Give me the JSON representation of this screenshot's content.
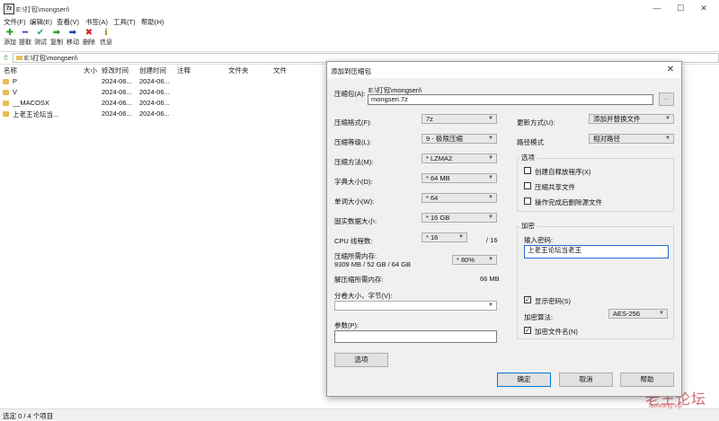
{
  "window": {
    "title": "E:\\打包\\mongseri\\",
    "minimize": "—",
    "maximize": "☐",
    "close": "✕"
  },
  "menu": [
    "文件(F)",
    "编辑(E)",
    "查看(V)",
    "书签(A)",
    "工具(T)",
    "帮助(H)"
  ],
  "toolbar": [
    {
      "label": "添加",
      "icon": "add-icon",
      "glyph": "✚",
      "color": "#2aa02a"
    },
    {
      "label": "提取",
      "icon": "extract-icon",
      "glyph": "━",
      "color": "#1f3fb0"
    },
    {
      "label": "测试",
      "icon": "test-icon",
      "glyph": "✔",
      "color": "#1f9b9b"
    },
    {
      "label": "复制",
      "icon": "copy-icon",
      "glyph": "➡",
      "color": "#2aa02a"
    },
    {
      "label": "移动",
      "icon": "move-icon",
      "glyph": "➡",
      "color": "#1f3fb0"
    },
    {
      "label": "删除",
      "icon": "delete-icon",
      "glyph": "✖",
      "color": "#cc2222"
    },
    {
      "label": "信息",
      "icon": "info-icon",
      "glyph": "ℹ",
      "color": "#b08a20"
    }
  ],
  "address": {
    "path": "E:\\打包\\mongseri\\",
    "up_glyph": "⇧"
  },
  "columns": [
    "名称",
    "大小",
    "修改时间",
    "创建时间",
    "注释",
    "文件夹",
    "文件"
  ],
  "files": [
    {
      "name": "P",
      "modified": "2024-06...",
      "created": "2024-06..."
    },
    {
      "name": "V",
      "modified": "2024-06...",
      "created": "2024-06..."
    },
    {
      "name": "__MACOSX",
      "modified": "2024-06...",
      "created": "2024-06..."
    },
    {
      "name": "上老王论坛当...",
      "modified": "2024-06...",
      "created": "2024-06..."
    }
  ],
  "status": {
    "text": "选定 0 / 4 个项目"
  },
  "watermark": {
    "main": "老王论坛",
    "sub": "laowang.vip"
  },
  "dialog": {
    "title": "添加到压缩包",
    "close": "✕",
    "archive_label": "压缩包(A):",
    "archive_dir": "E:\\打包\\mongseri\\",
    "archive_name": "mongseri.7z",
    "browse": "...",
    "format_label": "压缩格式(F):",
    "format_value": "7z",
    "level_label": "压缩等级(L):",
    "level_value": "9 - 极限压缩",
    "method_label": "压缩方法(M):",
    "method_value": "* LZMA2",
    "dict_label": "字典大小(D):",
    "dict_value": "* 64 MB",
    "word_label": "单词大小(W):",
    "word_value": "* 64",
    "solid_label": "固实数据大小:",
    "solid_value": "* 16 GB",
    "threads_label": "CPU 线程数:",
    "threads_value": "* 16",
    "threads_max": "/ 16",
    "mem_label": "压缩所需内存:",
    "mem_detail": "9309 MB / 52 GB / 64 GB",
    "mem_value": "* 80%",
    "decomp_label": "解压缩所需内存:",
    "decomp_value": "66 MB",
    "split_label": "分卷大小，字节(V):",
    "split_value": "",
    "params_label": "参数(P):",
    "params_value": "",
    "options_btn": "选项",
    "update_label": "更新方式(U):",
    "update_value": "添加并替换文件",
    "path_label": "路径模式",
    "path_value": "相对路径",
    "options_group": "选项",
    "opt_sfx": "创建自释放程序(X)",
    "opt_shared": "压缩共享文件",
    "opt_delete": "操作完成后删除源文件",
    "enc_group": "加密",
    "pwd_label": "输入密码:",
    "pwd_value": "上老王论坛当老王",
    "show_pwd": "显示密码(S)",
    "enc_method_label": "加密算法:",
    "enc_method_value": "AES-256",
    "enc_names": "加密文件名(N)",
    "ok": "确定",
    "cancel": "取消",
    "help": "帮助"
  }
}
